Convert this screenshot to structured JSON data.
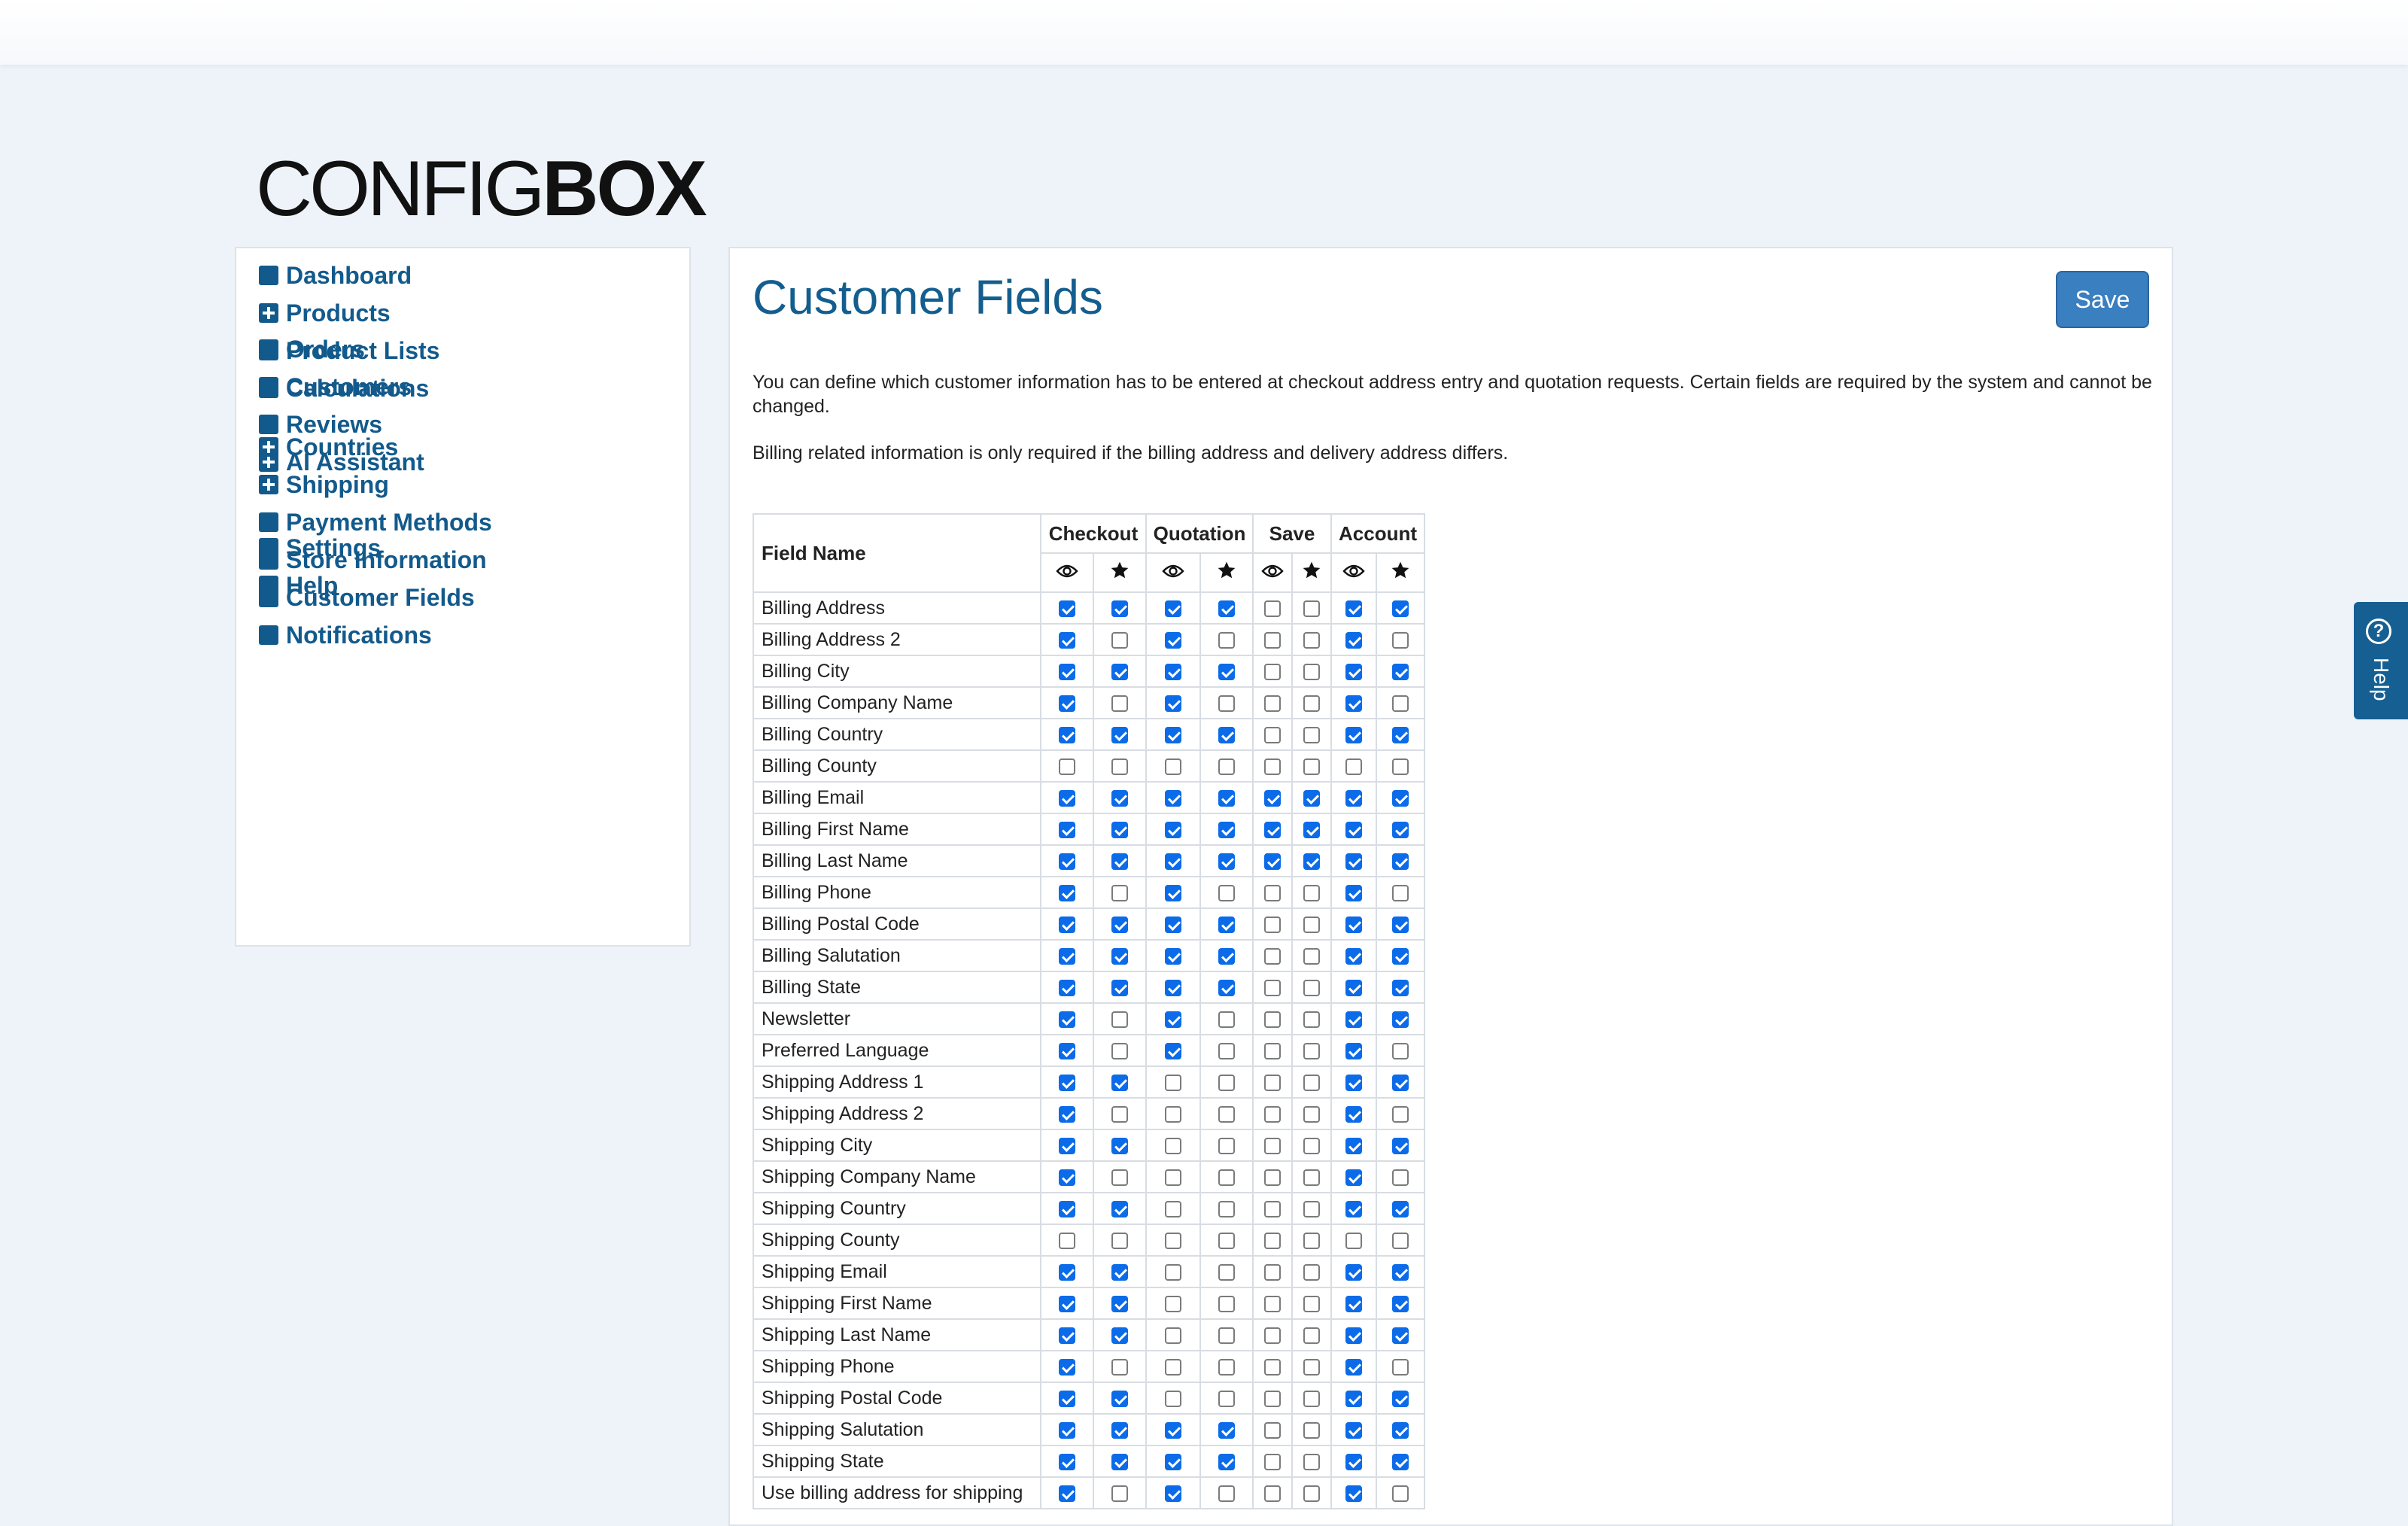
{
  "logo": {
    "thin": "CONFIG",
    "bold": "BOX"
  },
  "sidebar": {
    "groups": [
      [
        {
          "label": "Dashboard",
          "icon": "square-icon"
        },
        {
          "label": "Products",
          "icon": "plus-square-icon"
        },
        {
          "label": "Product Lists",
          "icon": "square-icon"
        },
        {
          "label": "Calculations",
          "icon": "square-icon"
        }
      ],
      [
        {
          "label": "Orders",
          "icon": "square-icon"
        },
        {
          "label": "Customers",
          "icon": "square-icon"
        },
        {
          "label": "Reviews",
          "icon": "square-icon"
        },
        {
          "label": "AI Assistant",
          "icon": "plus-square-icon"
        }
      ],
      [
        {
          "label": "Countries",
          "icon": "plus-square-icon"
        },
        {
          "label": "Shipping",
          "icon": "plus-square-icon"
        },
        {
          "label": "Payment Methods",
          "icon": "square-icon"
        },
        {
          "label": "Store Information",
          "icon": "square-icon"
        },
        {
          "label": "Customer Fields",
          "icon": "square-icon"
        },
        {
          "label": "Notifications",
          "icon": "square-icon"
        }
      ],
      [
        {
          "label": "Settings",
          "icon": "square-icon"
        },
        {
          "label": "Help",
          "icon": "square-icon"
        }
      ]
    ]
  },
  "main": {
    "title": "Customer Fields",
    "save_label": "Save",
    "description1": "You can define which customer information has to be entered at checkout address entry and quotation requests. Certain fields are required by the system and cannot be changed.",
    "description2": "Billing related information is only required if the billing address and delivery address differs."
  },
  "table": {
    "field_header": "Field Name",
    "groups": [
      "Checkout",
      "Quotation",
      "Save",
      "Account"
    ],
    "icon_columns": [
      "eye-icon",
      "star-icon",
      "eye-icon",
      "star-icon",
      "eye-icon",
      "star-icon",
      "eye-icon",
      "star-icon"
    ],
    "rows": [
      {
        "name": "Billing Address",
        "checks": [
          1,
          1,
          1,
          1,
          0,
          0,
          1,
          1
        ]
      },
      {
        "name": "Billing Address 2",
        "checks": [
          1,
          0,
          1,
          0,
          0,
          0,
          1,
          0
        ]
      },
      {
        "name": "Billing City",
        "checks": [
          1,
          1,
          1,
          1,
          0,
          0,
          1,
          1
        ]
      },
      {
        "name": "Billing Company Name",
        "checks": [
          1,
          0,
          1,
          0,
          0,
          0,
          1,
          0
        ]
      },
      {
        "name": "Billing Country",
        "checks": [
          1,
          1,
          1,
          1,
          0,
          0,
          1,
          1
        ]
      },
      {
        "name": "Billing County",
        "checks": [
          0,
          0,
          0,
          0,
          0,
          0,
          0,
          0
        ]
      },
      {
        "name": "Billing Email",
        "checks": [
          1,
          1,
          1,
          1,
          1,
          1,
          1,
          1
        ]
      },
      {
        "name": "Billing First Name",
        "checks": [
          1,
          1,
          1,
          1,
          1,
          1,
          1,
          1
        ]
      },
      {
        "name": "Billing Last Name",
        "checks": [
          1,
          1,
          1,
          1,
          1,
          1,
          1,
          1
        ]
      },
      {
        "name": "Billing Phone",
        "checks": [
          1,
          0,
          1,
          0,
          0,
          0,
          1,
          0
        ]
      },
      {
        "name": "Billing Postal Code",
        "checks": [
          1,
          1,
          1,
          1,
          0,
          0,
          1,
          1
        ]
      },
      {
        "name": "Billing Salutation",
        "checks": [
          1,
          1,
          1,
          1,
          0,
          0,
          1,
          1
        ]
      },
      {
        "name": "Billing State",
        "checks": [
          1,
          1,
          1,
          1,
          0,
          0,
          1,
          1
        ]
      },
      {
        "name": "Newsletter",
        "checks": [
          1,
          0,
          1,
          0,
          0,
          0,
          1,
          1
        ]
      },
      {
        "name": "Preferred Language",
        "checks": [
          1,
          0,
          1,
          0,
          0,
          0,
          1,
          0
        ]
      },
      {
        "name": "Shipping Address 1",
        "checks": [
          1,
          1,
          0,
          0,
          0,
          0,
          1,
          1
        ]
      },
      {
        "name": "Shipping Address 2",
        "checks": [
          1,
          0,
          0,
          0,
          0,
          0,
          1,
          0
        ]
      },
      {
        "name": "Shipping City",
        "checks": [
          1,
          1,
          0,
          0,
          0,
          0,
          1,
          1
        ]
      },
      {
        "name": "Shipping Company Name",
        "checks": [
          1,
          0,
          0,
          0,
          0,
          0,
          1,
          0
        ]
      },
      {
        "name": "Shipping Country",
        "checks": [
          1,
          1,
          0,
          0,
          0,
          0,
          1,
          1
        ]
      },
      {
        "name": "Shipping County",
        "checks": [
          0,
          0,
          0,
          0,
          0,
          0,
          0,
          0
        ]
      },
      {
        "name": "Shipping Email",
        "checks": [
          1,
          1,
          0,
          0,
          0,
          0,
          1,
          1
        ]
      },
      {
        "name": "Shipping First Name",
        "checks": [
          1,
          1,
          0,
          0,
          0,
          0,
          1,
          1
        ]
      },
      {
        "name": "Shipping Last Name",
        "checks": [
          1,
          1,
          0,
          0,
          0,
          0,
          1,
          1
        ]
      },
      {
        "name": "Shipping Phone",
        "checks": [
          1,
          0,
          0,
          0,
          0,
          0,
          1,
          0
        ]
      },
      {
        "name": "Shipping Postal Code",
        "checks": [
          1,
          1,
          0,
          0,
          0,
          0,
          1,
          1
        ]
      },
      {
        "name": "Shipping Salutation",
        "checks": [
          1,
          1,
          1,
          1,
          0,
          0,
          1,
          1
        ]
      },
      {
        "name": "Shipping State",
        "checks": [
          1,
          1,
          1,
          1,
          0,
          0,
          1,
          1
        ]
      },
      {
        "name": "Use billing address for shipping",
        "checks": [
          1,
          0,
          1,
          0,
          0,
          0,
          1,
          0
        ]
      }
    ]
  },
  "help_tab": {
    "label": "Help",
    "icon": "question-circle-icon"
  }
}
